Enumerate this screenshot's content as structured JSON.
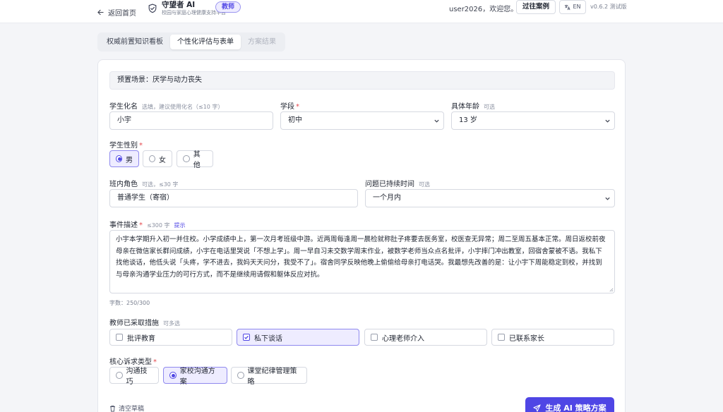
{
  "header": {
    "back_label": "返回首页",
    "app_title": "守望者 AI",
    "app_subtitle": "校园与家庭心理健康支持平台",
    "role_badge": "教师",
    "greeting": "user2026，欢迎您。",
    "cases_button": "过往案例",
    "lang_button": "EN",
    "version": "v0.6.2 测试版"
  },
  "tabs": [
    {
      "label": "权威前置知识看板",
      "state": "normal"
    },
    {
      "label": "个性化评估与表单",
      "state": "active"
    },
    {
      "label": "方案结果",
      "state": "disabled"
    }
  ],
  "form": {
    "scenario": "预置场景：厌学与动力丧失",
    "student_name": {
      "label": "学生化名",
      "hint": "选填，建议使用化名（≤10 字）",
      "value": "小宇"
    },
    "grade": {
      "label": "学段",
      "required": "*",
      "value": "初中"
    },
    "age": {
      "label": "具体年龄",
      "hint": "可选",
      "value": "13 岁"
    },
    "gender": {
      "label": "学生性别",
      "required": "*",
      "options": [
        "男",
        "女",
        "其他"
      ],
      "selected": 0
    },
    "class_role": {
      "label": "班内角色",
      "hint": "可选，≤30 字",
      "value": "普通学生（寄宿）"
    },
    "duration": {
      "label": "问题已持续时间",
      "hint": "可选",
      "value": "一个月内"
    },
    "event": {
      "label": "事件描述",
      "required": "*",
      "hint": "≤300 字",
      "link": "提示",
      "value": "小宇本学期升入初一并住校。小学成绩中上，第一次月考班级中游。近两周每逢周一晨检就称肚子疼要去医务室，校医查无异常；周二至周五基本正常。周日返校前夜母亲在微信家长群问成绩，小宇在电话里哭说「不想上学」。周一早自习未交数学周末作业，被数学老师当众点名批评，小宇摔门冲出教室，回宿舍蒙被不语。我私下找他谈话，他低头说「头疼，学不进去，我妈天天问分，我受不了」。宿舍同学反映他晚上偷偷给母亲打电话哭。我最想先改善的是：让小宇下周能稳定到校，并找到与母亲沟通学业压力的可行方式，而不是继续用请假和躯体反应对抗。",
      "counter": "字数：250/300"
    },
    "measures": {
      "label": "教师已采取措施",
      "hint": "可多选",
      "options": [
        "批评教育",
        "私下谈话",
        "心理老师介入",
        "已联系家长"
      ],
      "selected": [
        1
      ]
    },
    "appeal": {
      "label": "核心诉求类型",
      "required": "*",
      "options": [
        "沟通技巧",
        "家校沟通方案",
        "课堂纪律管理策略"
      ],
      "selected": 1
    },
    "clear_label": "清空草稿",
    "generate_label": "生成 AI 策略方案"
  },
  "colors": {
    "accent": "#4f46e5",
    "accent_light": "#eeecff",
    "required": "#e5484d"
  }
}
